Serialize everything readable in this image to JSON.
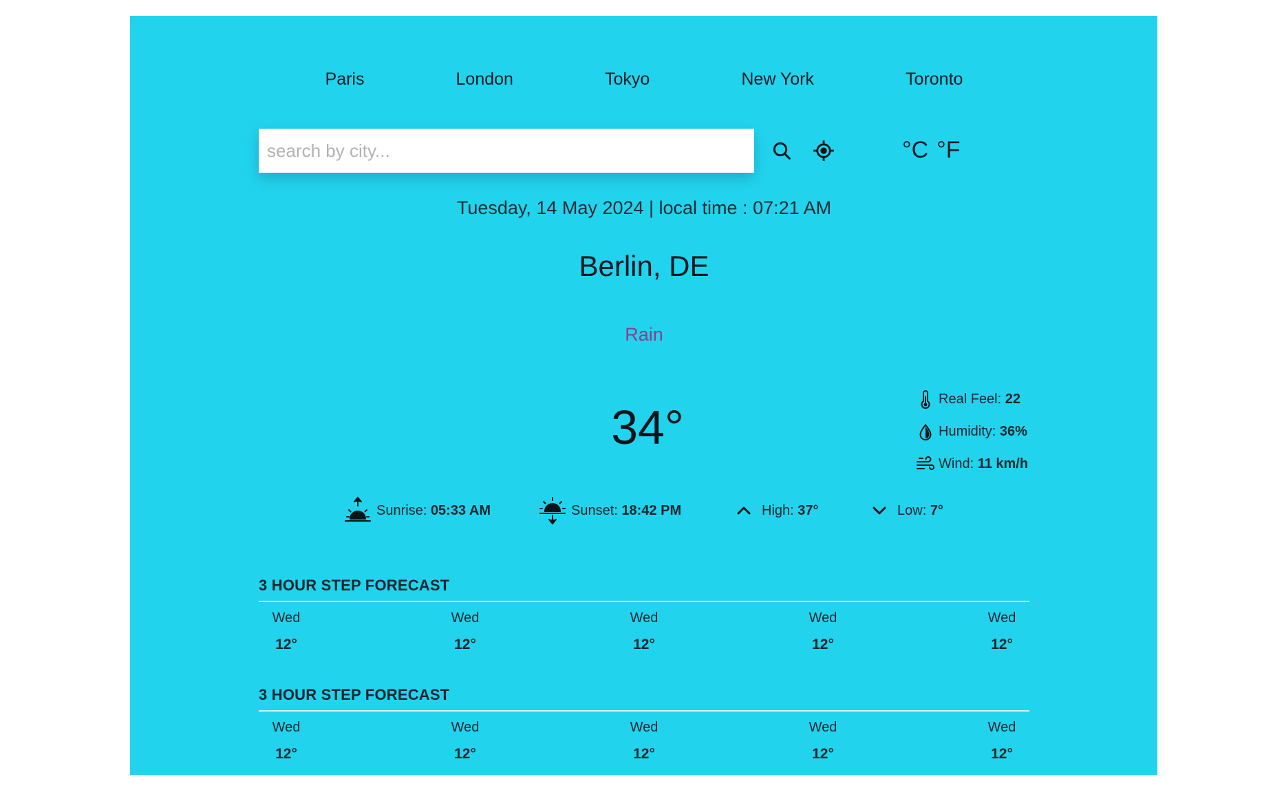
{
  "cities": [
    "Paris",
    "London",
    "Tokyo",
    "New York",
    "Toronto"
  ],
  "search": {
    "placeholder": "search by city...",
    "value": ""
  },
  "units": {
    "celsius": "°C",
    "fahrenheit": "°F"
  },
  "datetime": "Tuesday, 14 May 2024 | local time : 07:21 AM",
  "location": "Berlin, DE",
  "condition": "Rain",
  "temperature": "34°",
  "details": {
    "real_feel_label": "Real Feel:",
    "real_feel_value": "22",
    "humidity_label": "Humidity:",
    "humidity_value": "36%",
    "wind_label": "Wind:",
    "wind_value": "11 km/h"
  },
  "stats": {
    "sunrise_label": "Sunrise:",
    "sunrise_value": "05:33 AM",
    "sunset_label": "Sunset:",
    "sunset_value": "18:42 PM",
    "high_label": "High:",
    "high_value": "37°",
    "low_label": "Low:",
    "low_value": "7°"
  },
  "forecasts": [
    {
      "title": "3 HOUR STEP FORECAST",
      "items": [
        {
          "day": "Wed",
          "temp": "12°"
        },
        {
          "day": "Wed",
          "temp": "12°"
        },
        {
          "day": "Wed",
          "temp": "12°"
        },
        {
          "day": "Wed",
          "temp": "12°"
        },
        {
          "day": "Wed",
          "temp": "12°"
        }
      ]
    },
    {
      "title": "3 HOUR STEP FORECAST",
      "items": [
        {
          "day": "Wed",
          "temp": "12°"
        },
        {
          "day": "Wed",
          "temp": "12°"
        },
        {
          "day": "Wed",
          "temp": "12°"
        },
        {
          "day": "Wed",
          "temp": "12°"
        },
        {
          "day": "Wed",
          "temp": "12°"
        }
      ]
    }
  ],
  "icons": {
    "search": "search-icon",
    "location": "location-crosshair-icon",
    "real_feel": "thermometer-icon",
    "humidity": "droplet-icon",
    "wind": "wind-icon",
    "sunrise": "sunrise-icon",
    "sunset": "sunset-icon",
    "high": "chevron-up-icon",
    "low": "chevron-down-icon"
  },
  "colors": {
    "background": "#22d3ee",
    "condition": "#8b3e8f",
    "page": "#ffffff"
  }
}
